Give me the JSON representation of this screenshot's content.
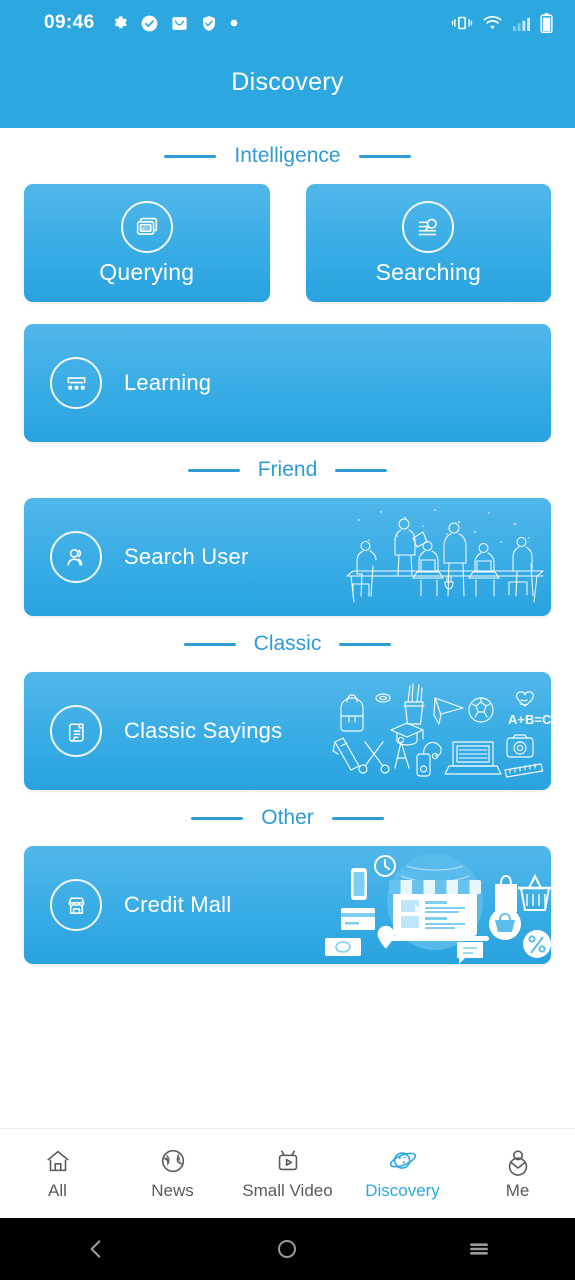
{
  "status_bar": {
    "time": "09:46",
    "left_icons": [
      "gear-icon",
      "check-circle-icon",
      "mail-icon",
      "shield-check-icon",
      "dot-icon"
    ],
    "right_icons": [
      "vibrate-icon",
      "wifi-icon",
      "signal-icon",
      "battery-icon"
    ]
  },
  "app_bar": {
    "title": "Discovery"
  },
  "theme": {
    "primary": "#2CA7E0",
    "accent": "#2E9BD6",
    "card_top": "#51B7EA",
    "card_bottom": "#28A3DF",
    "active_tab": "#29A8E6",
    "inactive_tab": "#5A5A5A"
  },
  "sections": [
    {
      "title": "Intelligence",
      "tiles": [
        {
          "label": "Querying",
          "icon": "abc-cards-icon"
        },
        {
          "label": "Searching",
          "icon": "search-lines-icon"
        }
      ],
      "wide": [
        {
          "label": "Learning",
          "icon": "classroom-icon",
          "art": "none"
        }
      ]
    },
    {
      "title": "Friend",
      "tiles": [],
      "wide": [
        {
          "label": "Search User",
          "icon": "user-group-icon",
          "art": "meeting-people-illustration"
        }
      ]
    },
    {
      "title": "Classic",
      "tiles": [],
      "wide": [
        {
          "label": "Classic Sayings",
          "icon": "scroll-document-icon",
          "art": "school-supplies-illustration",
          "art_text": "A+B=C"
        }
      ]
    },
    {
      "title": "Other",
      "tiles": [],
      "wide": [
        {
          "label": "Credit Mall",
          "icon": "shop-icon",
          "art": "ecommerce-illustration"
        }
      ]
    }
  ],
  "tab_bar": {
    "items": [
      {
        "label": "All",
        "icon": "home-icon",
        "active": false
      },
      {
        "label": "News",
        "icon": "globe-icon",
        "active": false
      },
      {
        "label": "Small Video",
        "icon": "tv-play-icon",
        "active": false
      },
      {
        "label": "Discovery",
        "icon": "planet-icon",
        "active": true
      },
      {
        "label": "Me",
        "icon": "person-icon",
        "active": false
      }
    ]
  },
  "nav_bar": {
    "items": [
      {
        "name": "back-button",
        "icon": "chevron-left-icon"
      },
      {
        "name": "home-button",
        "icon": "circle-icon"
      },
      {
        "name": "recents-button",
        "icon": "hamburger-icon"
      }
    ]
  }
}
